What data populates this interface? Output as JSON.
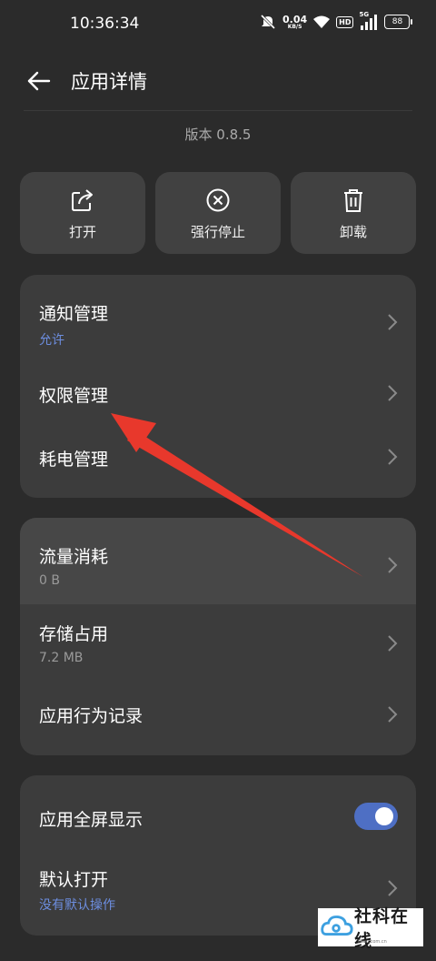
{
  "status_bar": {
    "time": "10:36:34",
    "net_speed_value": "0.04",
    "net_speed_unit": "KB/S",
    "hd_label": "HD",
    "signal_label": "5G",
    "battery": "88"
  },
  "header": {
    "title": "应用详情"
  },
  "app": {
    "version": "版本 0.8.5"
  },
  "actions": [
    {
      "label": "打开",
      "icon": "open-external-icon"
    },
    {
      "label": "强行停止",
      "icon": "force-stop-icon"
    },
    {
      "label": "卸载",
      "icon": "trash-icon"
    }
  ],
  "card1": {
    "items": [
      {
        "title": "通知管理",
        "subtitle": "允许"
      },
      {
        "title": "权限管理"
      },
      {
        "title": "耗电管理"
      }
    ]
  },
  "card2": {
    "items": [
      {
        "title": "流量消耗",
        "subtitle": "0 B"
      },
      {
        "title": "存储占用",
        "subtitle": "7.2 MB"
      },
      {
        "title": "应用行为记录"
      }
    ]
  },
  "card3": {
    "items": [
      {
        "title": "应用全屏显示",
        "toggle_on": true
      },
      {
        "title": "默认打开",
        "subtitle": "没有默认操作"
      }
    ]
  },
  "watermark": {
    "text": "社科在线",
    "url": "tlsoo.com.cn"
  },
  "colors": {
    "background": "#2b2b2b",
    "card": "#3c3c3c",
    "accent_blue": "#6d8ee0",
    "toggle_on": "#4e6fc4",
    "annotation_arrow": "#e8382c"
  }
}
